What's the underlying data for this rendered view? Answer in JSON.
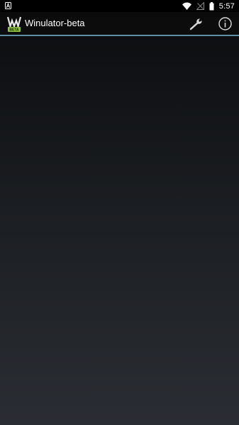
{
  "status_bar": {
    "time": "5:57",
    "icons": [
      "notification-a-icon",
      "wifi-icon",
      "no-signal-icon",
      "battery-icon"
    ]
  },
  "action_bar": {
    "title": "Winulator-beta",
    "logo_badge": "BETA",
    "actions": [
      "wrench-icon",
      "info-icon"
    ]
  },
  "colors": {
    "accent_divider": "#5f8ea8",
    "logo_green": "#8dc63f",
    "background_top": "#0d0f11",
    "background_bottom": "#2a2d33"
  }
}
